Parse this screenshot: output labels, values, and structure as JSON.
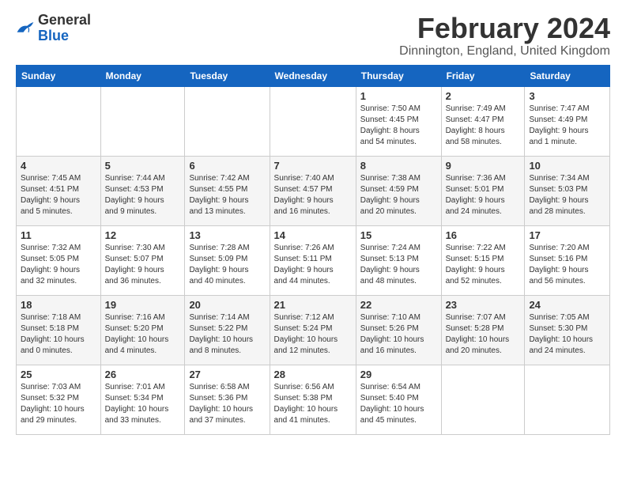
{
  "header": {
    "logo_general": "General",
    "logo_blue": "Blue",
    "title": "February 2024",
    "location": "Dinnington, England, United Kingdom"
  },
  "days_of_week": [
    "Sunday",
    "Monday",
    "Tuesday",
    "Wednesday",
    "Thursday",
    "Friday",
    "Saturday"
  ],
  "weeks": [
    [
      {
        "day": "",
        "info": ""
      },
      {
        "day": "",
        "info": ""
      },
      {
        "day": "",
        "info": ""
      },
      {
        "day": "",
        "info": ""
      },
      {
        "day": "1",
        "info": "Sunrise: 7:50 AM\nSunset: 4:45 PM\nDaylight: 8 hours\nand 54 minutes."
      },
      {
        "day": "2",
        "info": "Sunrise: 7:49 AM\nSunset: 4:47 PM\nDaylight: 8 hours\nand 58 minutes."
      },
      {
        "day": "3",
        "info": "Sunrise: 7:47 AM\nSunset: 4:49 PM\nDaylight: 9 hours\nand 1 minute."
      }
    ],
    [
      {
        "day": "4",
        "info": "Sunrise: 7:45 AM\nSunset: 4:51 PM\nDaylight: 9 hours\nand 5 minutes."
      },
      {
        "day": "5",
        "info": "Sunrise: 7:44 AM\nSunset: 4:53 PM\nDaylight: 9 hours\nand 9 minutes."
      },
      {
        "day": "6",
        "info": "Sunrise: 7:42 AM\nSunset: 4:55 PM\nDaylight: 9 hours\nand 13 minutes."
      },
      {
        "day": "7",
        "info": "Sunrise: 7:40 AM\nSunset: 4:57 PM\nDaylight: 9 hours\nand 16 minutes."
      },
      {
        "day": "8",
        "info": "Sunrise: 7:38 AM\nSunset: 4:59 PM\nDaylight: 9 hours\nand 20 minutes."
      },
      {
        "day": "9",
        "info": "Sunrise: 7:36 AM\nSunset: 5:01 PM\nDaylight: 9 hours\nand 24 minutes."
      },
      {
        "day": "10",
        "info": "Sunrise: 7:34 AM\nSunset: 5:03 PM\nDaylight: 9 hours\nand 28 minutes."
      }
    ],
    [
      {
        "day": "11",
        "info": "Sunrise: 7:32 AM\nSunset: 5:05 PM\nDaylight: 9 hours\nand 32 minutes."
      },
      {
        "day": "12",
        "info": "Sunrise: 7:30 AM\nSunset: 5:07 PM\nDaylight: 9 hours\nand 36 minutes."
      },
      {
        "day": "13",
        "info": "Sunrise: 7:28 AM\nSunset: 5:09 PM\nDaylight: 9 hours\nand 40 minutes."
      },
      {
        "day": "14",
        "info": "Sunrise: 7:26 AM\nSunset: 5:11 PM\nDaylight: 9 hours\nand 44 minutes."
      },
      {
        "day": "15",
        "info": "Sunrise: 7:24 AM\nSunset: 5:13 PM\nDaylight: 9 hours\nand 48 minutes."
      },
      {
        "day": "16",
        "info": "Sunrise: 7:22 AM\nSunset: 5:15 PM\nDaylight: 9 hours\nand 52 minutes."
      },
      {
        "day": "17",
        "info": "Sunrise: 7:20 AM\nSunset: 5:16 PM\nDaylight: 9 hours\nand 56 minutes."
      }
    ],
    [
      {
        "day": "18",
        "info": "Sunrise: 7:18 AM\nSunset: 5:18 PM\nDaylight: 10 hours\nand 0 minutes."
      },
      {
        "day": "19",
        "info": "Sunrise: 7:16 AM\nSunset: 5:20 PM\nDaylight: 10 hours\nand 4 minutes."
      },
      {
        "day": "20",
        "info": "Sunrise: 7:14 AM\nSunset: 5:22 PM\nDaylight: 10 hours\nand 8 minutes."
      },
      {
        "day": "21",
        "info": "Sunrise: 7:12 AM\nSunset: 5:24 PM\nDaylight: 10 hours\nand 12 minutes."
      },
      {
        "day": "22",
        "info": "Sunrise: 7:10 AM\nSunset: 5:26 PM\nDaylight: 10 hours\nand 16 minutes."
      },
      {
        "day": "23",
        "info": "Sunrise: 7:07 AM\nSunset: 5:28 PM\nDaylight: 10 hours\nand 20 minutes."
      },
      {
        "day": "24",
        "info": "Sunrise: 7:05 AM\nSunset: 5:30 PM\nDaylight: 10 hours\nand 24 minutes."
      }
    ],
    [
      {
        "day": "25",
        "info": "Sunrise: 7:03 AM\nSunset: 5:32 PM\nDaylight: 10 hours\nand 29 minutes."
      },
      {
        "day": "26",
        "info": "Sunrise: 7:01 AM\nSunset: 5:34 PM\nDaylight: 10 hours\nand 33 minutes."
      },
      {
        "day": "27",
        "info": "Sunrise: 6:58 AM\nSunset: 5:36 PM\nDaylight: 10 hours\nand 37 minutes."
      },
      {
        "day": "28",
        "info": "Sunrise: 6:56 AM\nSunset: 5:38 PM\nDaylight: 10 hours\nand 41 minutes."
      },
      {
        "day": "29",
        "info": "Sunrise: 6:54 AM\nSunset: 5:40 PM\nDaylight: 10 hours\nand 45 minutes."
      },
      {
        "day": "",
        "info": ""
      },
      {
        "day": "",
        "info": ""
      }
    ]
  ]
}
